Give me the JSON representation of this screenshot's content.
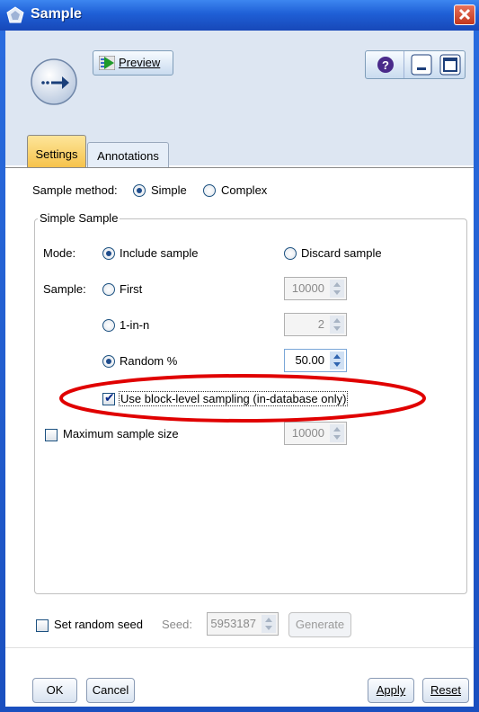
{
  "window": {
    "title": "Sample"
  },
  "toolbar": {
    "preview_label": "Preview"
  },
  "tabs": [
    {
      "label": "Settings",
      "active": true
    },
    {
      "label": "Annotations",
      "active": false
    }
  ],
  "sample_method": {
    "label": "Sample method:",
    "options": [
      "Simple",
      "Complex"
    ],
    "selected": "Simple"
  },
  "simple_sample": {
    "group_title": "Simple Sample",
    "mode": {
      "label": "Mode:",
      "include": "Include sample",
      "discard": "Discard sample",
      "selected": "Include sample"
    },
    "sample": {
      "label": "Sample:",
      "first": {
        "label": "First",
        "value": "10000"
      },
      "one_in_n": {
        "label": "1-in-n",
        "value": "2"
      },
      "random": {
        "label": "Random %",
        "value": "50.00"
      },
      "selected": "Random %"
    },
    "block_level": {
      "label": "Use block-level sampling (in-database only)",
      "checked": true
    },
    "max_size": {
      "label": "Maximum sample size",
      "value": "10000",
      "checked": false
    }
  },
  "seed": {
    "checkbox_label": "Set random seed",
    "seed_label": "Seed:",
    "value": "5953187",
    "generate_label": "Generate",
    "checked": false
  },
  "footer": {
    "ok": "OK",
    "cancel": "Cancel",
    "apply": "Apply",
    "reset": "Reset"
  },
  "colors": {
    "title_bar": "#1f5fd6",
    "header_bg": "#dde6f2",
    "active_tab": "#f6c24a",
    "annotation_ellipse": "#e00000"
  }
}
